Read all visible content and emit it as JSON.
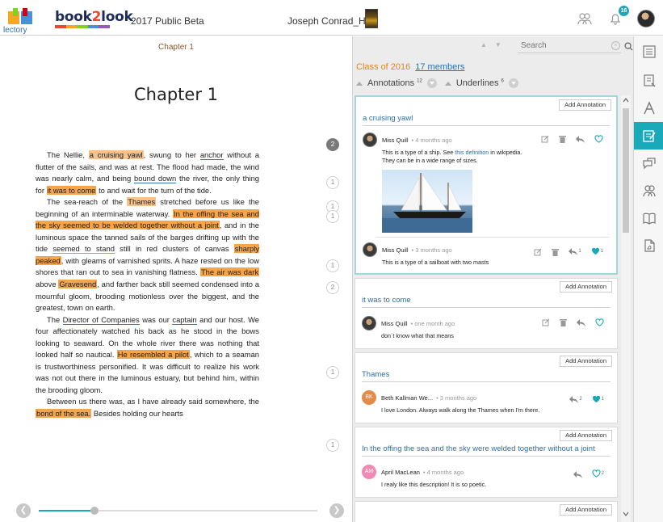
{
  "header": {
    "lectory_label": "lectory",
    "brand_prefix": "book",
    "brand_number": "2",
    "brand_suffix": "look",
    "edition": "2017 Public Beta",
    "book_title": "Joseph Conrad_H...",
    "notification_count": "16",
    "colors": {
      "accent": "#19a9b8",
      "brand_navy": "#1e2a57",
      "brand_orange": "#e84a2f"
    }
  },
  "reader": {
    "running_head": "Chapter 1",
    "chapter_title": "Chapter 1",
    "p1": {
      "t0": "The Nellie, ",
      "h1": "a cruising yawl",
      "t1": ", swung to her ",
      "u1": "anchor",
      "t2": " without a flutter of the sails, and was at rest. The flood had made, the wind was nearly calm, and being ",
      "u2": "bound down",
      "t3": " the river, the only thing for ",
      "h2": "it was to come",
      "t4": " to and wait for the turn of the tide."
    },
    "p2": {
      "t0": "The sea-reach of the ",
      "h1": "Thames",
      "t1": " stretched before us like the beginning of an interminable waterway. ",
      "h2": "In the offing the sea and the sky seemed to be welded together without a joint",
      "t2": ", and in the luminous space the tanned sails of the barges drifting up with the tide ",
      "u1": "seemed to stand",
      "t3": " still in red clusters of canvas ",
      "h3": "sharply peaked",
      "t4": ", with gleams of varnished sprits. A haze rested on the low shores that ran out to sea in vanishing flatness. ",
      "h4": "The air was dark",
      "t5": " above ",
      "h5": "Gravesend",
      "t6": ", and farther back still seemed condensed into a mournful gloom, brooding motionless over the biggest, and the greatest, town on earth."
    },
    "p3": {
      "t0": "The ",
      "u1": "Director of Companies",
      "t1": " was our ",
      "u2": "captain",
      "t2": " and our host. We four affectionately watched his back as he stood in the bows looking to seaward. On the whole river there was nothing that looked half so nautical. ",
      "h1": "He resembled a pilot",
      "t3": ", which to a seaman is trustworthiness personified. It was difficult to realize his work was not out there in the luminous estuary, but behind him, within the brooding gloom."
    },
    "p4": {
      "t0": "Between us there was, as I have already said somewhere, the ",
      "h1": "bond of the sea.",
      "t1": " Besides holding our hearts"
    },
    "markers": [
      "2",
      "1",
      "1",
      "1",
      "1",
      "2",
      "1",
      "1"
    ]
  },
  "panel": {
    "search_placeholder": "Search",
    "class_label": "Class of 2016",
    "members_link": "17 members",
    "annotations_label": "Annotations",
    "annotations_count": "12",
    "underlines_label": "Underlines",
    "underlines_count": "6",
    "add_annotation_label": "Add Annotation",
    "cards": [
      {
        "title": "a cruising yawl",
        "notes": [
          {
            "author": "Miss Quill",
            "time": "• 4 months ago",
            "body_1": "This is a type of a ship. See ",
            "link": "this definition",
            "body_2": " in wikipedia.",
            "body_3": "They can be in a wide range of sizes."
          },
          {
            "author": "Miss Quill",
            "time": "• 3 months ago",
            "body": "This is a type of a sailboat with two masts",
            "reply_count": "1",
            "like_count": "1"
          }
        ]
      },
      {
        "title": "it was to come",
        "notes": [
          {
            "author": "Miss Quill",
            "time": "• one month ago",
            "body": "don´t know what that means"
          }
        ]
      },
      {
        "title": "Thames",
        "notes": [
          {
            "initials": "BK",
            "author": "Beth Kallman We...",
            "time": "• 3 months ago",
            "body": "I love London. Always walk along the Thames when I'm there.",
            "reply_count": "2",
            "like_count": "1"
          }
        ]
      },
      {
        "title": "In the offing the sea and the sky were welded together without a joint",
        "notes": [
          {
            "initials": "AM",
            "author": "April MacLean",
            "time": "• 4 months ago",
            "body": "I realy like this description! It is so poetic.",
            "like_count": "2"
          }
        ]
      }
    ]
  },
  "sidebar": {
    "items": [
      "table-of-contents-icon",
      "notes-icon",
      "font-size-icon",
      "annotate-icon",
      "discussion-icon",
      "members-icon",
      "reading-icon",
      "export-pdf-icon"
    ],
    "active_index": 3
  },
  "progress": {
    "fraction": 0.2
  }
}
